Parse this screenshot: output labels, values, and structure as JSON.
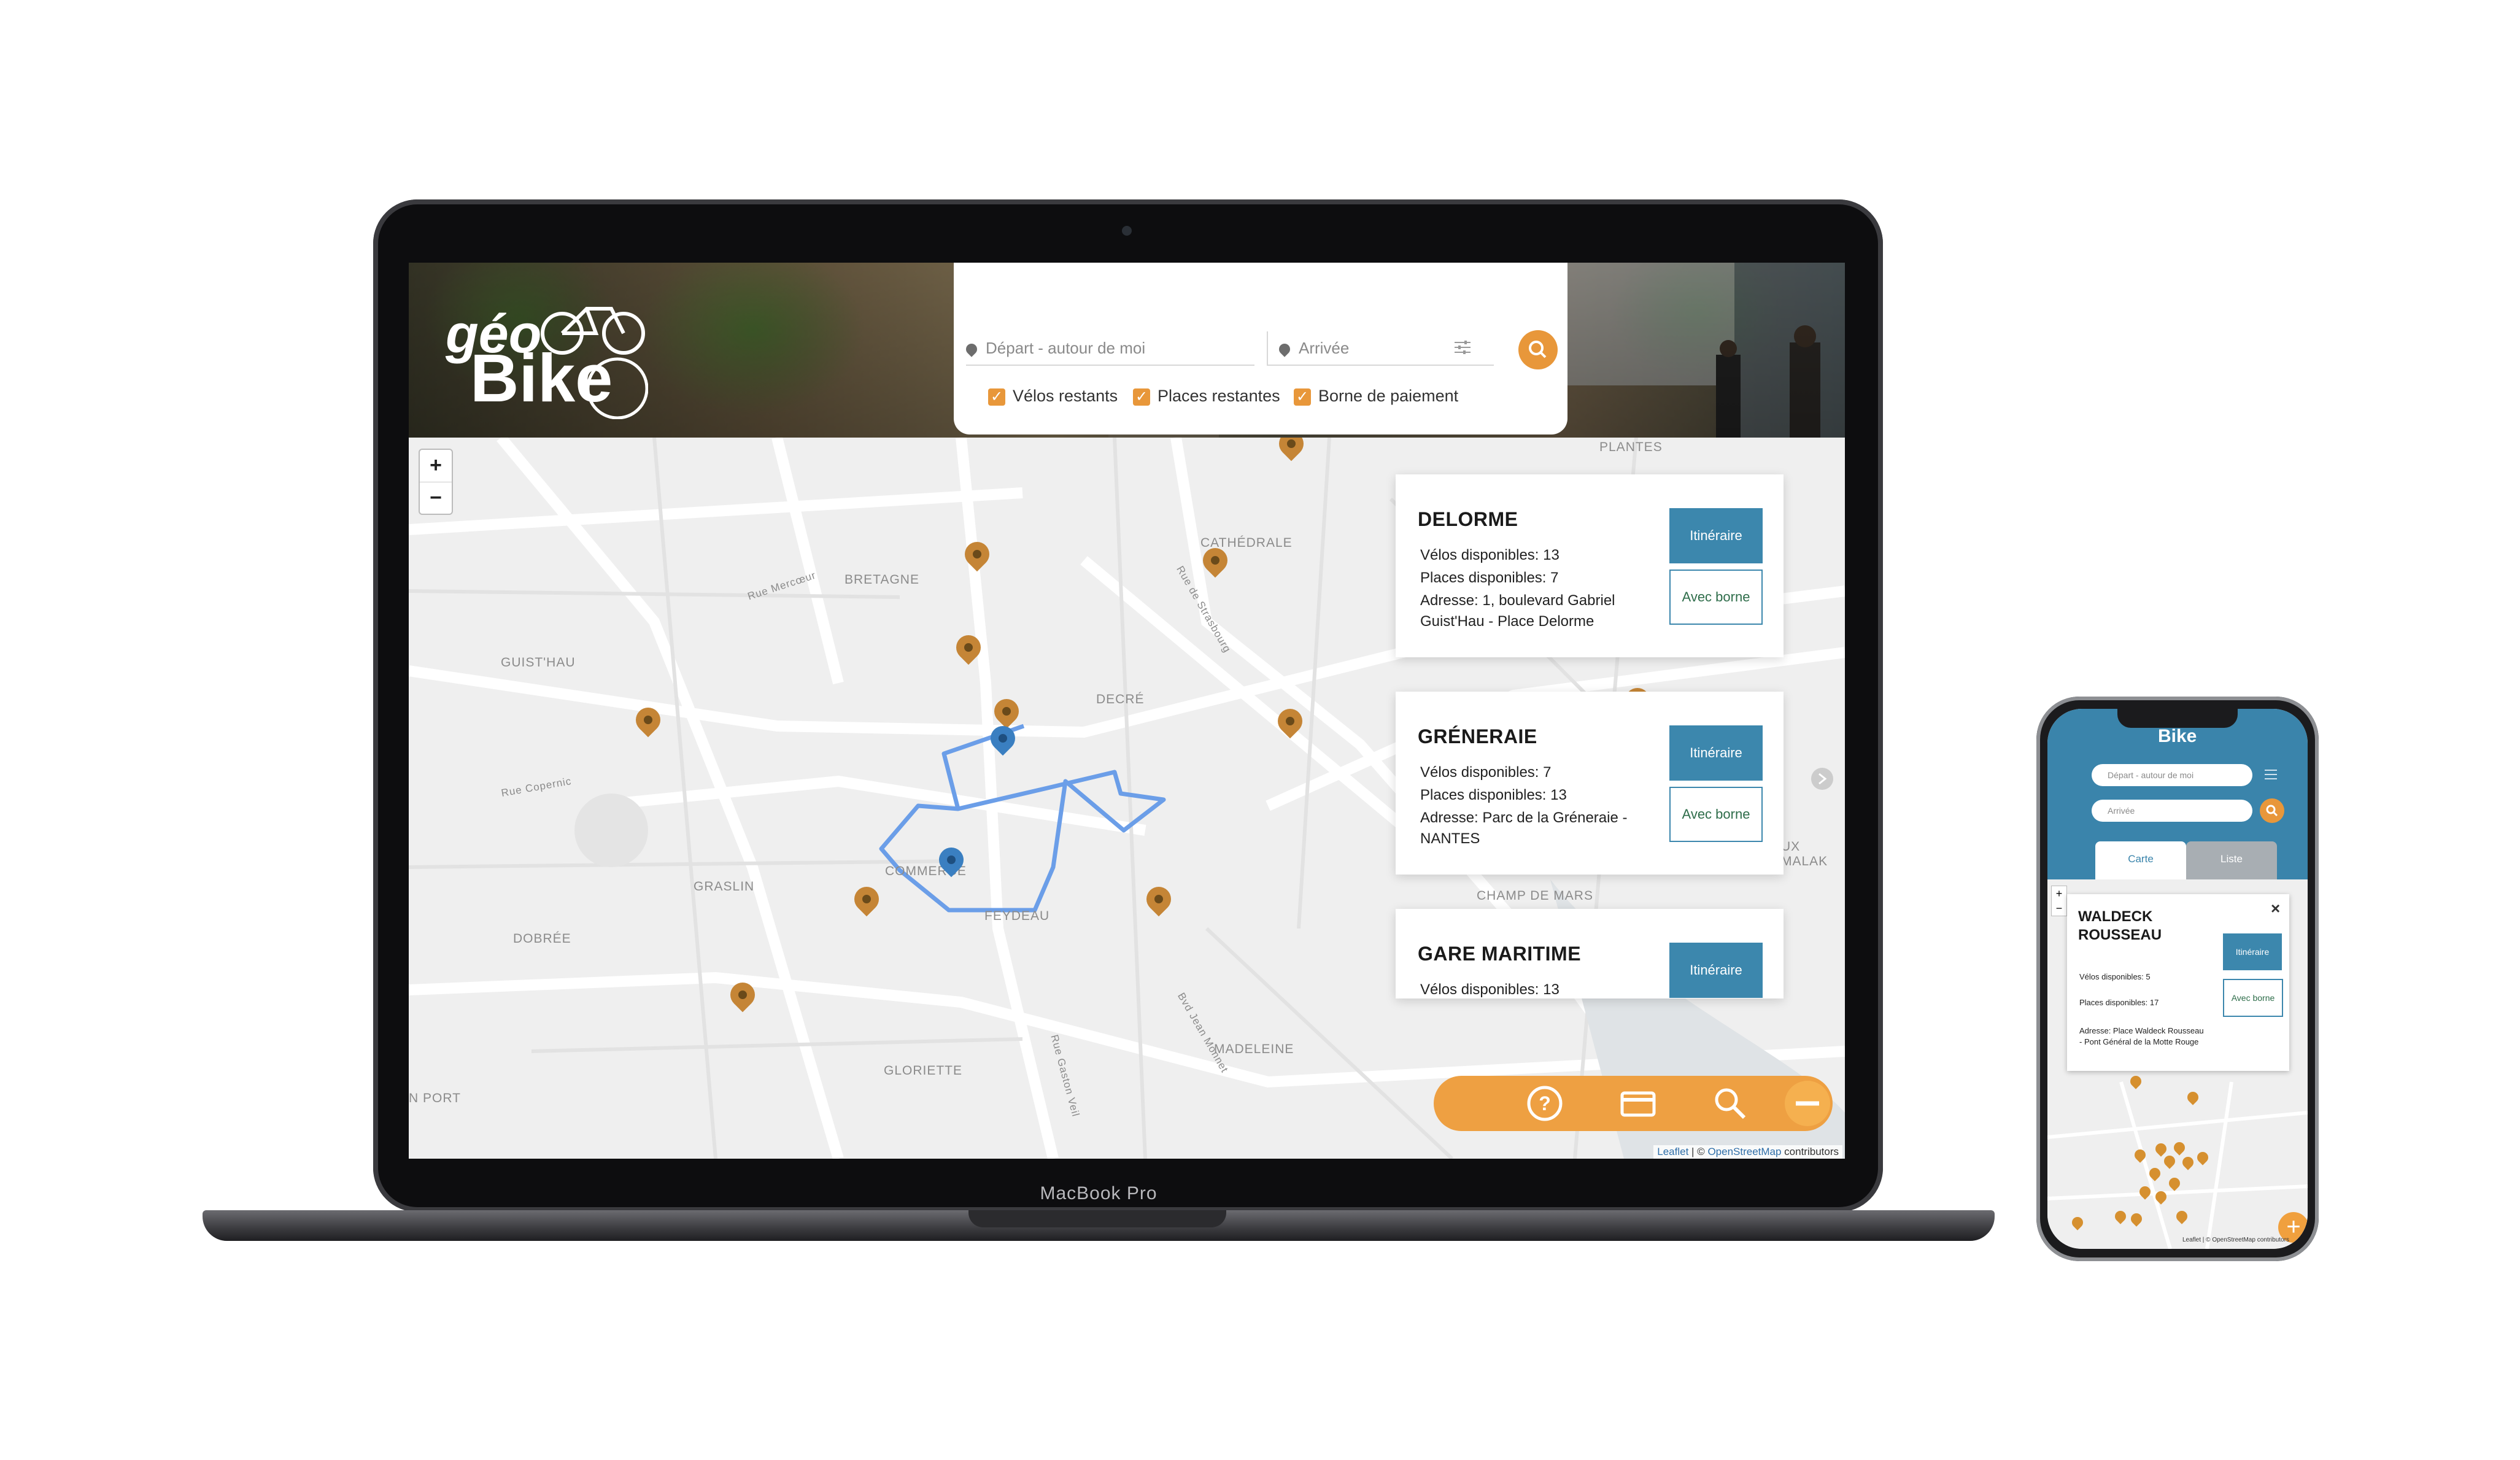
{
  "laptop": {
    "label": "MacBook Pro"
  },
  "app": {
    "logo_top": "géo",
    "logo_bottom": "Bike",
    "search": {
      "start_placeholder": "Départ - autour de moi",
      "end_placeholder": "Arrivée"
    },
    "filters": [
      {
        "label": "Vélos restants",
        "checked": true
      },
      {
        "label": "Places restantes",
        "checked": true
      },
      {
        "label": "Borne de paiement",
        "checked": true
      }
    ],
    "zoom": {
      "in": "+",
      "out": "−"
    },
    "map_labels": {
      "plantes": "PLANTES",
      "cathedrale": "CATHÉDRALE",
      "bretagne": "BRETAGNE",
      "guist_hau": "GUIST'HAU",
      "decre": "DECRÉ",
      "commerce": "COMMERCE",
      "graslin": "GRASLIN",
      "feydeau": "FEYDEAU",
      "dobree": "DOBRÉE",
      "champ_de_mars": "CHAMP DE MARS",
      "madeleine": "MADELEINE",
      "gloriette": "GLORIETTE",
      "port": "N PORT",
      "aux_malak": "UX MALAK",
      "rue_mercoeur": "Rue Mercœur",
      "rue_copernic": "Rue Copernic",
      "rue_strasbourg": "Rue de Strasbourg",
      "bvd_jean_monnet": "Bvd Jean Monnet",
      "rue_gaston_veil": "Rue Gaston Veil"
    },
    "stations": [
      {
        "name": "DELORME",
        "bikes": "Vélos disponibles: 13",
        "places": "Places disponibles: 7",
        "address": "Adresse: 1, boulevard Gabriel Guist'Hau - Place Delorme",
        "itinerary_label": "Itinéraire",
        "borne_label": "Avec borne"
      },
      {
        "name": "GRÉNERAIE",
        "bikes": "Vélos disponibles: 7",
        "places": "Places disponibles: 13",
        "address": "Adresse: Parc de la Gréneraie - NANTES",
        "itinerary_label": "Itinéraire",
        "borne_label": "Avec borne"
      },
      {
        "name": "GARE MARITIME",
        "bikes": "Vélos disponibles: 13",
        "itinerary_label": "Itinéraire"
      }
    ],
    "bottom_bar": [
      "help-icon",
      "card-icon",
      "search-icon",
      "minus-icon"
    ],
    "attribution": {
      "leaflet": "Leaflet",
      "sep": " | © ",
      "osm": "OpenStreetMap",
      "contrib": " contributors"
    },
    "colors": {
      "accent": "#e8973a",
      "primary": "#3c87ad",
      "pin": "#c58536",
      "route": "#6b9ee8"
    }
  },
  "phone": {
    "logo": "Bike",
    "start_placeholder": "Départ - autour de moi",
    "end_placeholder": "Arrivée",
    "tab_map": "Carte",
    "tab_list": "Liste",
    "popup": {
      "name": "WALDECK ROUSSEAU",
      "bikes": "Vélos disponibles: 5",
      "places": "Places disponibles: 17",
      "address": "Adresse: Place Waldeck Rousseau - Pont Général de la Motte Rouge",
      "itinerary_label": "Itinéraire",
      "borne_label": "Avec borne",
      "close": "×"
    },
    "zoom": {
      "in": "+",
      "out": "−"
    },
    "fab": "+",
    "attribution": "Leaflet | © OpenStreetMap contributors"
  }
}
